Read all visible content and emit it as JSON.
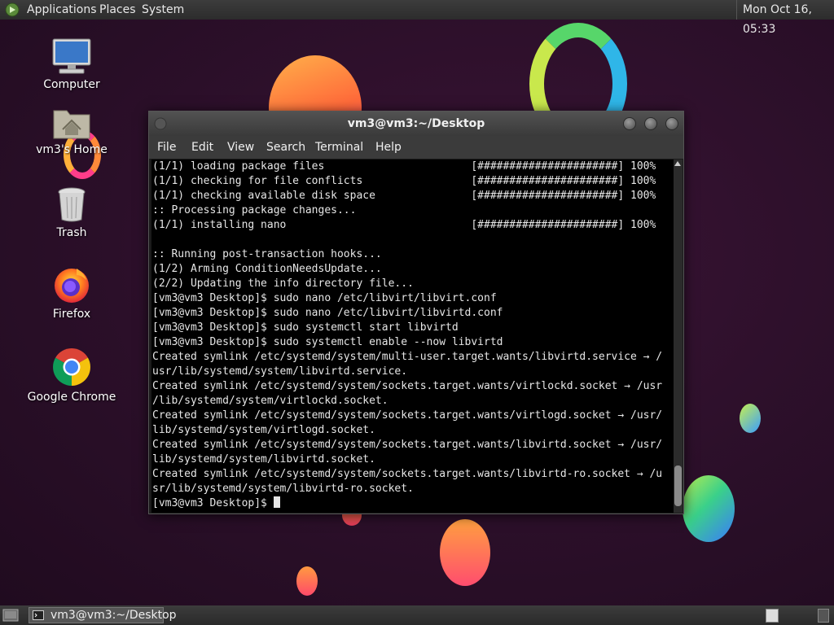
{
  "top_panel": {
    "menus": [
      "Applications",
      "Places",
      "System"
    ],
    "clock": "Mon Oct 16, 05:33"
  },
  "desktop_icons": [
    {
      "label": "Computer",
      "icon": "computer-icon"
    },
    {
      "label": "vm3's Home",
      "icon": "home-folder-icon"
    },
    {
      "label": "Trash",
      "icon": "trash-icon"
    },
    {
      "label": "Firefox",
      "icon": "firefox-icon"
    },
    {
      "label": "Google Chrome",
      "icon": "chrome-icon"
    }
  ],
  "terminal": {
    "title": "vm3@vm3:~/Desktop",
    "menu": [
      "File",
      "Edit",
      "View",
      "Search",
      "Terminal",
      "Help"
    ],
    "lines": [
      "(1/1) loading package files                       [######################] 100%",
      "(1/1) checking for file conflicts                 [######################] 100%",
      "(1/1) checking available disk space               [######################] 100%",
      ":: Processing package changes...",
      "(1/1) installing nano                             [######################] 100%",
      "",
      ":: Running post-transaction hooks...",
      "(1/2) Arming ConditionNeedsUpdate...",
      "(2/2) Updating the info directory file...",
      "[vm3@vm3 Desktop]$ sudo nano /etc/libvirt/libvirt.conf",
      "[vm3@vm3 Desktop]$ sudo nano /etc/libvirt/libvirtd.conf",
      "[vm3@vm3 Desktop]$ sudo systemctl start libvirtd",
      "[vm3@vm3 Desktop]$ sudo systemctl enable --now libvirtd",
      "Created symlink /etc/systemd/system/multi-user.target.wants/libvirtd.service → /",
      "usr/lib/systemd/system/libvirtd.service.",
      "Created symlink /etc/systemd/system/sockets.target.wants/virtlockd.socket → /usr",
      "/lib/systemd/system/virtlockd.socket.",
      "Created symlink /etc/systemd/system/sockets.target.wants/virtlogd.socket → /usr/",
      "lib/systemd/system/virtlogd.socket.",
      "Created symlink /etc/systemd/system/sockets.target.wants/libvirtd.socket → /usr/",
      "lib/systemd/system/libvirtd.socket.",
      "Created symlink /etc/systemd/system/sockets.target.wants/libvirtd-ro.socket → /u",
      "sr/lib/systemd/system/libvirtd-ro.socket.",
      "[vm3@vm3 Desktop]$ "
    ]
  },
  "taskbar": {
    "window_button": "vm3@vm3:~/Desktop"
  },
  "colors": {
    "desktop_bg": "#2b0f29",
    "panel_bg": "#333333",
    "terminal_bg": "#000000",
    "terminal_fg": "#e6e6e6"
  }
}
